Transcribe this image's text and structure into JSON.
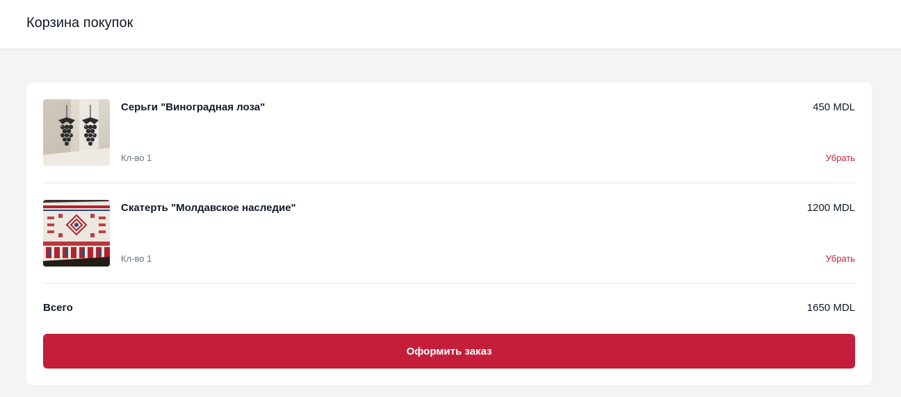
{
  "header": {
    "title": "Корзина покупок"
  },
  "cart": {
    "items": [
      {
        "name": "Серьги \"Виноградная лоза\"",
        "price": "450 MDL",
        "qty": "Кл-во 1",
        "remove_label": "Убрать",
        "thumb_icon": "earrings-photo"
      },
      {
        "name": "Скатерть \"Молдавское наследие\"",
        "price": "1200 MDL",
        "qty": "Кл-во 1",
        "remove_label": "Убрать",
        "thumb_icon": "tablecloth-photo"
      }
    ],
    "total_label": "Всего",
    "total_value": "1650 MDL",
    "checkout_label": "Оформить заказ"
  },
  "colors": {
    "accent": "#c41e3a",
    "page_bg": "#f3f4f6",
    "card_bg": "#ffffff",
    "muted_text": "#6b7280"
  }
}
